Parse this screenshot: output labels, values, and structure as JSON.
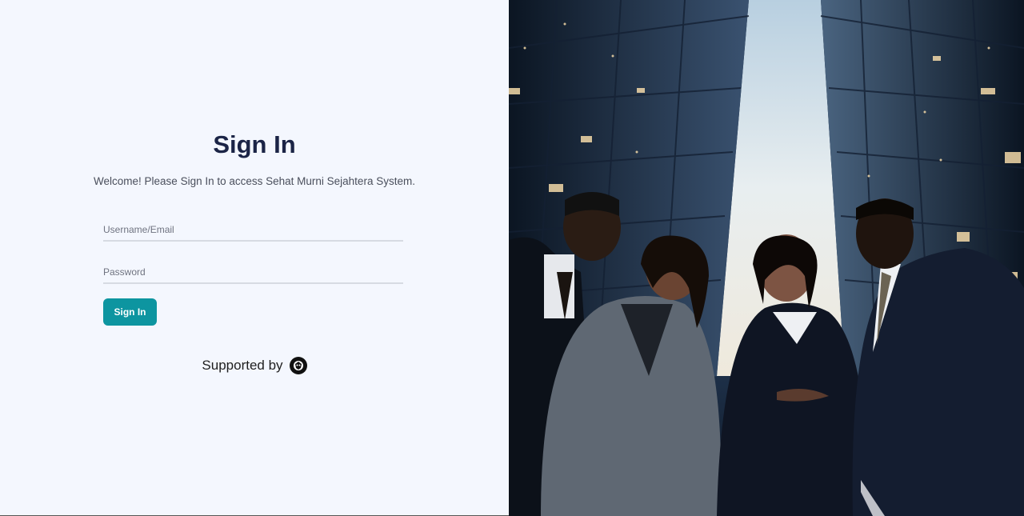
{
  "login": {
    "title": "Sign In",
    "subtitle": "Welcome! Please Sign In to access Sehat Murni Sejahtera System.",
    "username_placeholder": "Username/Email",
    "password_placeholder": "Password",
    "signin_button": "Sign In",
    "supported_by": "Supported by"
  },
  "icons": {
    "supporter_logo": "supporter-logo-icon"
  },
  "colors": {
    "background": "#f4f7fe",
    "title": "#1b2446",
    "button": "#0d95a0",
    "field_underline": "#d7dbe3"
  }
}
